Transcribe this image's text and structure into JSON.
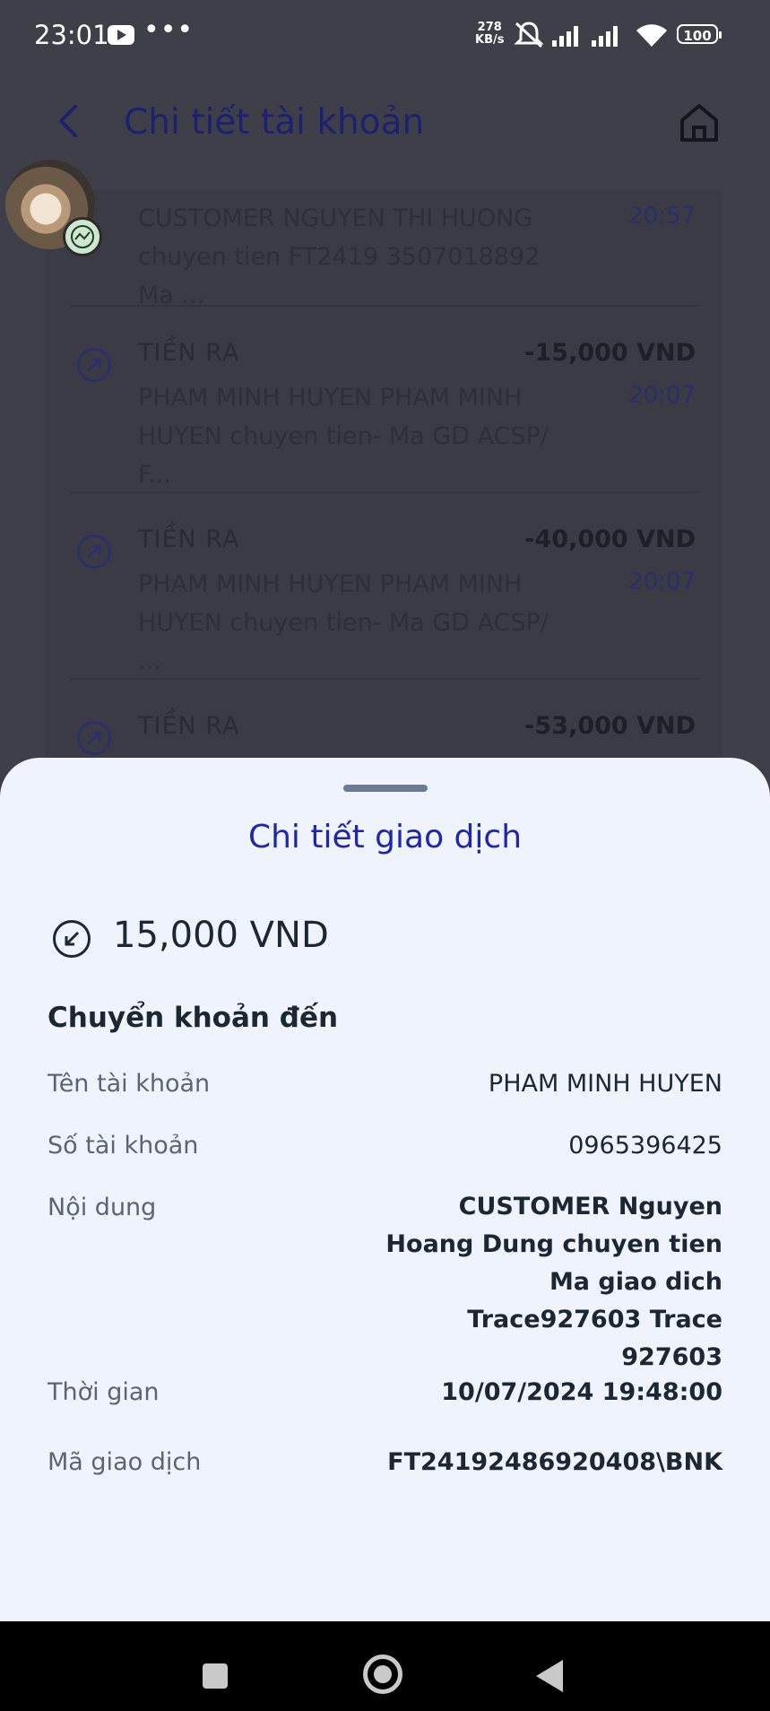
{
  "status_bar": {
    "time": "23:01",
    "more": "•••",
    "speed_value": "278",
    "speed_unit": "KB/s",
    "battery": "100"
  },
  "header": {
    "title": "Chi tiết tài khoản"
  },
  "transactions": [
    {
      "type": "",
      "amount": "",
      "desc_line1": "CUSTOMER NGUYEN THI HUONG",
      "desc_line2": "chuyen tien FT2419 3507018892   Ma ...",
      "time": "20:57"
    },
    {
      "type": "TIỀN RA",
      "amount": "-15,000 VND",
      "desc_line1": "PHAM MINH HUYEN  PHAM MINH",
      "desc_line2": "HUYEN chuyen tien- Ma GD  ACSP/ F...",
      "time": "20:07"
    },
    {
      "type": "TIỀN RA",
      "amount": "-40,000 VND",
      "desc_line1": "PHAM MINH HUYEN  PHAM MINH",
      "desc_line2": "HUYEN chuyen tien- Ma GD  ACSP/ ...",
      "time": "20:07"
    },
    {
      "type": "TIỀN RA",
      "amount": "-53,000 VND",
      "desc_line1": "",
      "desc_line2": "",
      "time": ""
    }
  ],
  "sheet": {
    "title": "Chi tiết giao dịch",
    "amount": "15,000 VND",
    "section_title": "Chuyển khoản đến",
    "rows": {
      "account_name": {
        "label": "Tên tài khoản",
        "value": "PHAM MINH HUYEN"
      },
      "account_number": {
        "label": "Số tài khoản",
        "value": "0965396425"
      },
      "content": {
        "label": "Nội dung",
        "lines": [
          "CUSTOMER Nguyen",
          "Hoang Dung chuyen tien",
          "Ma  giao dich",
          "Trace927603 Trace 927603"
        ]
      },
      "time": {
        "label": "Thời gian",
        "value": "10/07/2024 19:48:00"
      },
      "tx_code": {
        "label": "Mã giao dịch",
        "value": "FT24192486920408\\BNK"
      }
    }
  },
  "colors": {
    "sheet_title": "#1f26a8",
    "header_title": "#1c2170",
    "overlay_bg": "#3e3f49",
    "sheet_bg": "#eff3fb"
  },
  "icons": [
    "back-arrow-icon",
    "home-icon",
    "outgoing-arrow-icon",
    "incoming-arrow-icon"
  ]
}
